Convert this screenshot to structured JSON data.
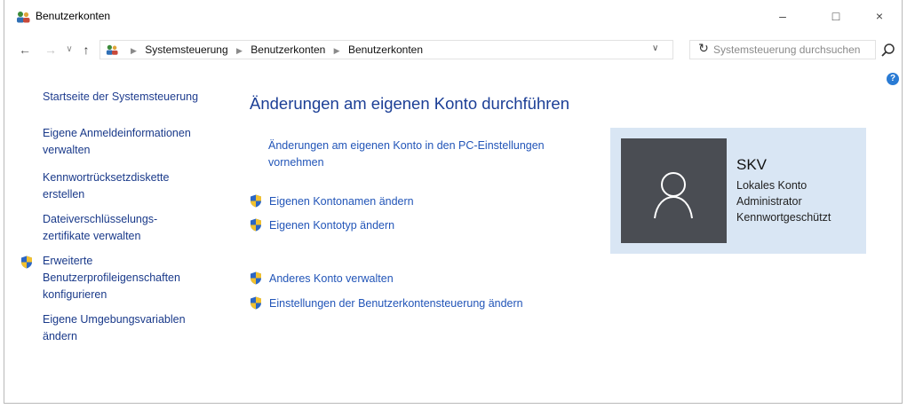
{
  "window": {
    "title": "Benutzerkonten",
    "minimize_glyph": "–",
    "maximize_glyph": "□",
    "close_glyph": "×"
  },
  "navigation": {
    "breadcrumbs": [
      "Systemsteuerung",
      "Benutzerkonten",
      "Benutzerkonten"
    ],
    "search_placeholder": "Systemsteuerung durchsuchen"
  },
  "left_pane": {
    "home_link": "Startseite der Systemsteuerung",
    "links": [
      "Eigene Anmeldeinformationen verwalten",
      "Kennwortrücksetzdiskette erstellen",
      "Dateiverschlüsselungs-zertifikate verwalten",
      "Erweiterte Benutzerprofileigenschaften konfigurieren",
      "Eigene Umgebungsvariablen ändern"
    ],
    "links_display": [
      [
        "Eigene Anmeldeinformationen",
        "verwalten"
      ],
      [
        "Kennwortrücksetzdiskette",
        "erstellen"
      ],
      [
        "Dateiverschlüsselungs-",
        "zertifikate verwalten"
      ],
      [
        "Erweiterte",
        "Benutzerprofileigenschaften",
        "konfigurieren"
      ],
      [
        "Eigene Umgebungsvariablen",
        "ändern"
      ]
    ]
  },
  "main": {
    "heading": "Änderungen am eigenen Konto durchführen",
    "pc_settings_link": [
      "Änderungen am eigenen Konto in den PC-Einstellungen",
      "vornehmen"
    ],
    "actions": [
      "Eigenen Kontonamen ändern",
      "Eigenen Kontotyp ändern"
    ],
    "other_actions": [
      "Anderes Konto verwalten",
      "Einstellungen der Benutzerkontensteuerung ändern"
    ]
  },
  "account": {
    "name": "SKV",
    "type": "Lokales Konto",
    "role": "Administrator",
    "protection": "Kennwortgeschützt"
  },
  "colors": {
    "link": "#2255b8",
    "heading": "#1c3f96",
    "card_background": "#d9e6f4",
    "avatar_background": "#4a4d53"
  }
}
